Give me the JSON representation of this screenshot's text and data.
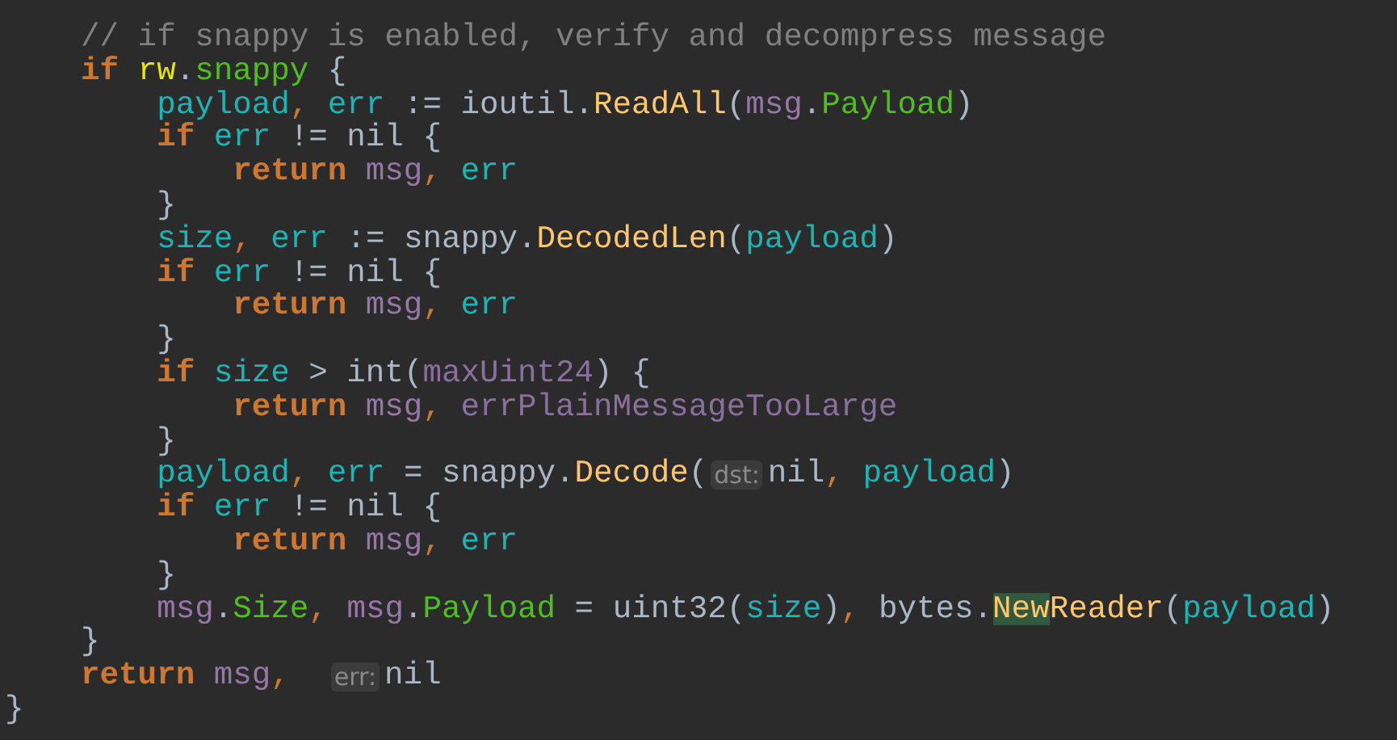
{
  "editor": {
    "lines": [
      {
        "tokens": [
          {
            "kind": "comment",
            "text": "    // if snappy is enabled, verify and decompress message"
          }
        ]
      },
      {
        "tokens": [
          {
            "kind": "keyword",
            "text": "    if "
          },
          {
            "kind": "receiver",
            "text": "rw"
          },
          {
            "kind": "plain",
            "text": "."
          },
          {
            "kind": "field",
            "text": "snappy"
          },
          {
            "kind": "plain",
            "text": " {"
          }
        ]
      },
      {
        "tokens": [
          {
            "kind": "variable",
            "text": "        payload"
          },
          {
            "kind": "punct",
            "text": ", "
          },
          {
            "kind": "variable",
            "text": "err"
          },
          {
            "kind": "plain",
            "text": " := ioutil."
          },
          {
            "kind": "function",
            "text": "ReadAll"
          },
          {
            "kind": "plain",
            "text": "("
          },
          {
            "kind": "object",
            "text": "msg"
          },
          {
            "kind": "plain",
            "text": "."
          },
          {
            "kind": "field",
            "text": "Payload"
          },
          {
            "kind": "plain",
            "text": ")"
          }
        ]
      },
      {
        "tokens": [
          {
            "kind": "keyword",
            "text": "        if "
          },
          {
            "kind": "variable",
            "text": "err"
          },
          {
            "kind": "plain",
            "text": " != nil {"
          }
        ]
      },
      {
        "tokens": [
          {
            "kind": "keyword",
            "text": "            return "
          },
          {
            "kind": "object",
            "text": "msg"
          },
          {
            "kind": "punct",
            "text": ", "
          },
          {
            "kind": "variable",
            "text": "err"
          }
        ]
      },
      {
        "tokens": [
          {
            "kind": "plain",
            "text": "        }"
          }
        ]
      },
      {
        "tokens": [
          {
            "kind": "variable",
            "text": "        size"
          },
          {
            "kind": "punct",
            "text": ", "
          },
          {
            "kind": "variable",
            "text": "err"
          },
          {
            "kind": "plain",
            "text": " := snappy."
          },
          {
            "kind": "function",
            "text": "DecodedLen"
          },
          {
            "kind": "plain",
            "text": "("
          },
          {
            "kind": "variable",
            "text": "payload"
          },
          {
            "kind": "plain",
            "text": ")"
          }
        ]
      },
      {
        "tokens": [
          {
            "kind": "keyword",
            "text": "        if "
          },
          {
            "kind": "variable",
            "text": "err"
          },
          {
            "kind": "plain",
            "text": " != nil {"
          }
        ]
      },
      {
        "tokens": [
          {
            "kind": "keyword",
            "text": "            return "
          },
          {
            "kind": "object",
            "text": "msg"
          },
          {
            "kind": "punct",
            "text": ", "
          },
          {
            "kind": "variable",
            "text": "err"
          }
        ]
      },
      {
        "tokens": [
          {
            "kind": "plain",
            "text": "        }"
          }
        ]
      },
      {
        "tokens": [
          {
            "kind": "keyword",
            "text": "        if "
          },
          {
            "kind": "variable",
            "text": "size"
          },
          {
            "kind": "plain",
            "text": " > int("
          },
          {
            "kind": "constant",
            "text": "maxUint24"
          },
          {
            "kind": "plain",
            "text": ") {"
          }
        ]
      },
      {
        "tokens": [
          {
            "kind": "keyword",
            "text": "            return "
          },
          {
            "kind": "object",
            "text": "msg"
          },
          {
            "kind": "punct",
            "text": ", "
          },
          {
            "kind": "constant",
            "text": "errPlainMessageTooLarge"
          }
        ]
      },
      {
        "tokens": [
          {
            "kind": "plain",
            "text": "        }"
          }
        ]
      },
      {
        "tokens": [
          {
            "kind": "variable",
            "text": "        payload"
          },
          {
            "kind": "punct",
            "text": ", "
          },
          {
            "kind": "variable",
            "text": "err"
          },
          {
            "kind": "plain",
            "text": " = snappy."
          },
          {
            "kind": "function",
            "text": "Decode"
          },
          {
            "kind": "plain",
            "text": "("
          },
          {
            "kind": "hint",
            "text": "dst:"
          },
          {
            "kind": "plain",
            "text": "nil"
          },
          {
            "kind": "punct",
            "text": ", "
          },
          {
            "kind": "variable",
            "text": "payload"
          },
          {
            "kind": "plain",
            "text": ")"
          }
        ]
      },
      {
        "tokens": [
          {
            "kind": "keyword",
            "text": "        if "
          },
          {
            "kind": "variable",
            "text": "err"
          },
          {
            "kind": "plain",
            "text": " != nil {"
          }
        ]
      },
      {
        "tokens": [
          {
            "kind": "keyword",
            "text": "            return "
          },
          {
            "kind": "object",
            "text": "msg"
          },
          {
            "kind": "punct",
            "text": ", "
          },
          {
            "kind": "variable",
            "text": "err"
          }
        ]
      },
      {
        "tokens": [
          {
            "kind": "plain",
            "text": "        }"
          }
        ]
      },
      {
        "tokens": [
          {
            "kind": "object",
            "text": "        msg"
          },
          {
            "kind": "plain",
            "text": "."
          },
          {
            "kind": "field",
            "text": "Size"
          },
          {
            "kind": "punct",
            "text": ", "
          },
          {
            "kind": "object",
            "text": "msg"
          },
          {
            "kind": "plain",
            "text": "."
          },
          {
            "kind": "field",
            "text": "Payload"
          },
          {
            "kind": "plain",
            "text": " = uint32("
          },
          {
            "kind": "variable",
            "text": "size"
          },
          {
            "kind": "plain",
            "text": ")"
          },
          {
            "kind": "punct",
            "text": ", "
          },
          {
            "kind": "plain",
            "text": "bytes."
          },
          {
            "kind": "match",
            "text": "New"
          },
          {
            "kind": "function",
            "text": "Reader"
          },
          {
            "kind": "plain",
            "text": "("
          },
          {
            "kind": "variable",
            "text": "payload"
          },
          {
            "kind": "plain",
            "text": ")"
          }
        ]
      },
      {
        "tokens": [
          {
            "kind": "plain",
            "text": "    }"
          }
        ]
      },
      {
        "tokens": [
          {
            "kind": "keyword",
            "text": "    return "
          },
          {
            "kind": "object",
            "text": "msg"
          },
          {
            "kind": "punct",
            "text": ",  "
          },
          {
            "kind": "hint",
            "text": "err:"
          },
          {
            "kind": "plain",
            "text": "nil"
          }
        ]
      },
      {
        "tokens": [
          {
            "kind": "plain",
            "text": "}"
          }
        ]
      }
    ]
  }
}
